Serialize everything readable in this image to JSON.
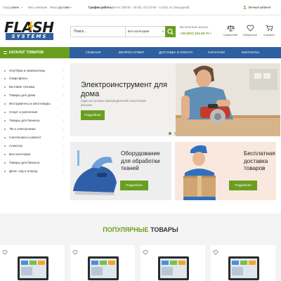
{
  "topbar": {
    "city_label": "Город:",
    "city_value": "Киев",
    "shop_label": "Весь магазин",
    "lang_label": "Язык:",
    "lang_value": "русский",
    "hours_label": "График работы:",
    "hours_text": "пн-пт (09:00 - 18:00), сб (10:00 - 14:00), вс (выходной)",
    "account_label": "Личный кабинет"
  },
  "header": {
    "logo_top": "FLASH",
    "logo_bottom": "SYSTEMS",
    "search_placeholder": "Поиск...",
    "search_category": "Все категории",
    "phone_label": "Бесплатный звонок:",
    "phone_number": "+38 (067) 224 68 70",
    "icons": [
      {
        "icon": "scales-icon",
        "label": "Сравнение"
      },
      {
        "icon": "heart-icon",
        "label": "Избранное"
      },
      {
        "icon": "cart-icon",
        "label": "Корзина"
      }
    ]
  },
  "catalog_label": "КАТАЛОГ ТОВАРОВ",
  "nav": [
    "ГЛАВНАЯ",
    "ВОПРОС-ОТВЕТ",
    "ДОСТАВКА И ОПЛАТА",
    "ГАРАНТИИ",
    "КОНТАКТЫ"
  ],
  "sidebar": [
    "Ноутбуки и компьютеры",
    "Смартфоны",
    "Бытовая техника",
    "Товары для дома",
    "Инструменты и автотовары",
    "Спорт и увлечения",
    "Товары для бизнеса",
    "ТВ и электроника",
    "Сантехника и ремонт",
    "Алкоголь",
    "Все категории",
    "Товары для бизнеса",
    "Дача, сад и огород"
  ],
  "hero": {
    "title": "Электроинструмент для дома",
    "subtitle": "Один из лучших производителей в восточной регионе",
    "button": "Подробнее"
  },
  "banners": [
    {
      "title": "Оборудование для обработки тканей",
      "button": "Подробнее"
    },
    {
      "title": "Бесплатная доставка товаров",
      "button": "Подробнее"
    }
  ],
  "popular": {
    "title_accent": "ПОПУЛЯРНЫЕ",
    "title_rest": "ТОВАРЫ"
  },
  "colors": {
    "accent_green": "#6a9e1f",
    "nav_blue": "#2e5f9e"
  }
}
